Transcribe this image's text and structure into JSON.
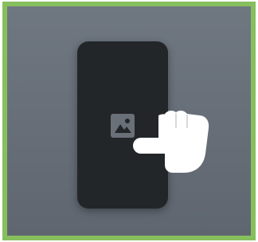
{
  "icons": {
    "image": "image-placeholder-icon",
    "hand": "tap-hand-icon"
  },
  "colors": {
    "border": "#86bf5c",
    "background_top": "#6f7781",
    "background_bottom": "#5f6670",
    "phone": "#232629",
    "icon": "#6a7078",
    "hand": "#ffffff"
  }
}
